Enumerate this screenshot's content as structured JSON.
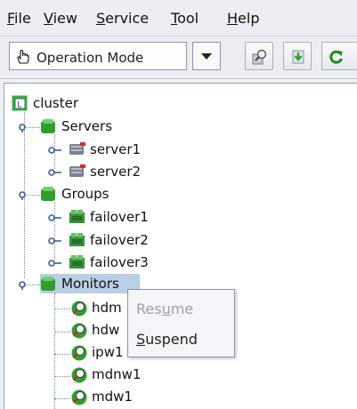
{
  "menubar": {
    "items": [
      {
        "pre": "",
        "u": "F",
        "post": "ile"
      },
      {
        "pre": "",
        "u": "V",
        "post": "iew"
      },
      {
        "pre": "",
        "u": "S",
        "post": "ervice"
      },
      {
        "pre": "",
        "u": "T",
        "post": "ool"
      },
      {
        "pre": "",
        "u": "H",
        "post": "elp"
      }
    ]
  },
  "toolbar": {
    "mode_label": "Operation Mode",
    "buttons": [
      "zoom-icon",
      "download-icon",
      "refresh-icon"
    ]
  },
  "tree": {
    "root": {
      "label": "cluster",
      "icon": "cluster-icon"
    },
    "servers": {
      "label": "Servers",
      "children": [
        "server1",
        "server2"
      ]
    },
    "groups": {
      "label": "Groups",
      "children": [
        "failover1",
        "failover2",
        "failover3"
      ]
    },
    "monitors": {
      "label": "Monitors",
      "children": [
        "hdm",
        "hdw",
        "ipw1",
        "mdnw1",
        "mdw1"
      ]
    }
  },
  "context_menu": {
    "resume": {
      "pre": "Res",
      "u": "u",
      "post": "me",
      "disabled": true
    },
    "suspend": {
      "pre": "",
      "u": "S",
      "post": "uspend",
      "disabled": false
    }
  },
  "colors": {
    "folder_green": "#2f9e2f",
    "selection": "#b8cfe5",
    "disabled_text": "#9aa0aa"
  }
}
